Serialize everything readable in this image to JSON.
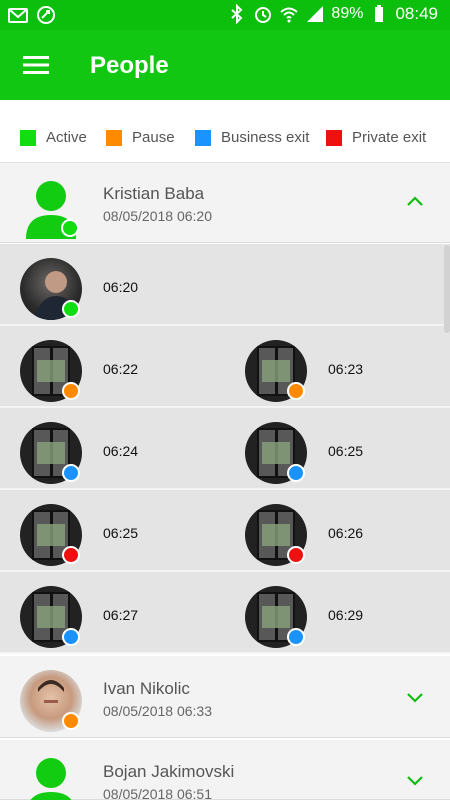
{
  "status_bar": {
    "battery": "89%",
    "time": "08:49",
    "icons": [
      "gmail-icon",
      "sync-icon",
      "bluetooth-icon",
      "alarm-icon",
      "wifi-icon",
      "signal-icon",
      "battery-icon"
    ]
  },
  "app_bar": {
    "title": "People",
    "menu_icon": "hamburger-menu-icon"
  },
  "legend": [
    {
      "label": "Active",
      "color": "#11dd11"
    },
    {
      "label": "Pause",
      "color": "#ff8a00"
    },
    {
      "label": "Business exit",
      "color": "#1b93ff"
    },
    {
      "label": "Private exit",
      "color": "#ee1111"
    }
  ],
  "people": [
    {
      "name": "Kristian Baba",
      "datetime": "08/05/2018 06:20",
      "status_color": "#11dd11",
      "expanded": true
    },
    {
      "name": "Ivan Nikolic",
      "datetime": "08/05/2018 06:33",
      "status_color": "#ff8a00",
      "expanded": false
    },
    {
      "name": "Bojan Jakimovski",
      "datetime": "08/05/2018 06:51",
      "expanded": false
    }
  ],
  "events": [
    {
      "time": "06:20",
      "status": "Active",
      "color": "#11dd11"
    },
    {
      "time": "06:22",
      "status": "Pause",
      "color": "#ff8a00"
    },
    {
      "time": "06:23",
      "status": "Pause",
      "color": "#ff8a00"
    },
    {
      "time": "06:24",
      "status": "Business exit",
      "color": "#1b93ff"
    },
    {
      "time": "06:25",
      "status": "Business exit",
      "color": "#1b93ff"
    },
    {
      "time": "06:25",
      "status": "Private exit",
      "color": "#ee1111"
    },
    {
      "time": "06:26",
      "status": "Private exit",
      "color": "#ee1111"
    },
    {
      "time": "06:27",
      "status": "Business exit",
      "color": "#1b93ff"
    },
    {
      "time": "06:29",
      "status": "Business exit",
      "color": "#1b93ff"
    }
  ]
}
